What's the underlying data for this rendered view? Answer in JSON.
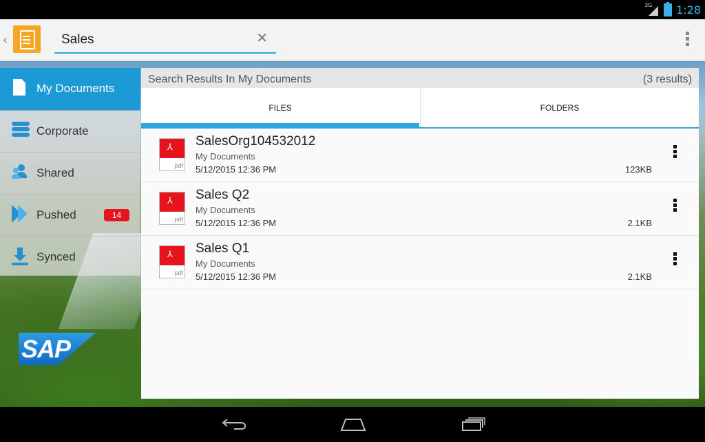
{
  "status_bar": {
    "network": "3G",
    "time": "1:28"
  },
  "app_bar": {
    "search": {
      "value": "Sales",
      "placeholder": ""
    }
  },
  "sidebar": {
    "items": [
      {
        "label": "My Documents",
        "icon": "document-icon",
        "active": true
      },
      {
        "label": "Corporate",
        "icon": "database-icon"
      },
      {
        "label": "Shared",
        "icon": "people-icon"
      },
      {
        "label": "Pushed",
        "icon": "push-icon",
        "badge": "14"
      },
      {
        "label": "Synced",
        "icon": "download-icon"
      }
    ],
    "logo": "SAP"
  },
  "results": {
    "title": "Search Results In My Documents",
    "count": "(3 results)",
    "tabs": [
      {
        "label": "FILES",
        "active": true
      },
      {
        "label": "FOLDERS"
      }
    ],
    "files": [
      {
        "name": "SalesOrg104532012",
        "folder": "My Documents",
        "date": "5/12/2015 12:36 PM",
        "size": "123KB",
        "type": "pdf"
      },
      {
        "name": "Sales Q2",
        "folder": "My Documents",
        "date": "5/12/2015 12:36 PM",
        "size": "2.1KB",
        "type": "pdf"
      },
      {
        "name": "Sales Q1",
        "folder": "My Documents",
        "date": "5/12/2015 12:36 PM",
        "size": "2.1KB",
        "type": "pdf"
      }
    ]
  },
  "colors": {
    "accent": "#33a5de",
    "active_nav": "#1b9ad6",
    "badge": "#e8141d",
    "app_icon": "#f5a623"
  }
}
